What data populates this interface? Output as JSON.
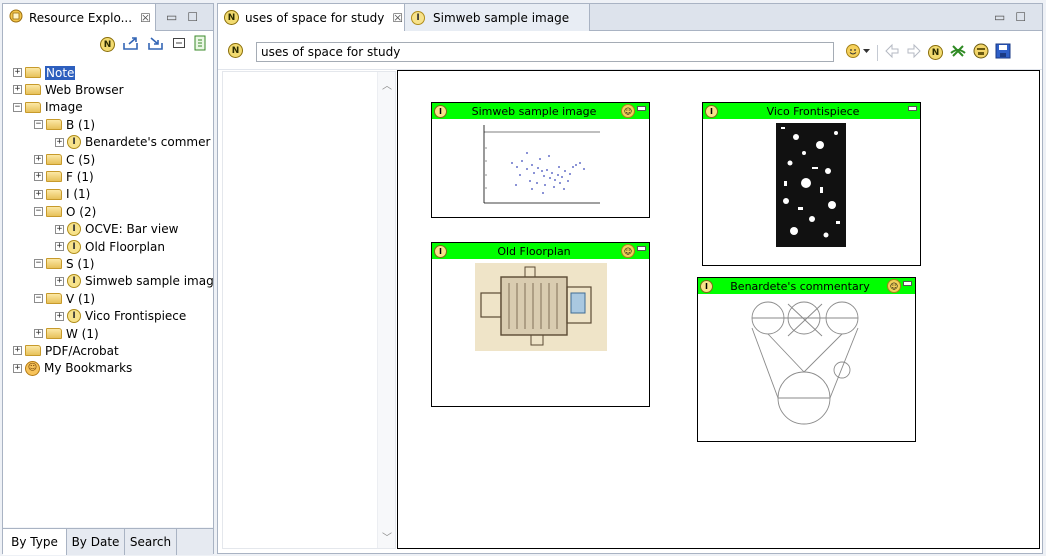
{
  "left_panel": {
    "view_title": "Resource Explo...",
    "close_glyph": "☒",
    "tree": [
      {
        "label": "Note",
        "kind": "folder",
        "expander": "+",
        "indent": 0,
        "selected": true
      },
      {
        "label": "Web Browser",
        "kind": "folder",
        "expander": "+",
        "indent": 0
      },
      {
        "label": "Image",
        "kind": "folder",
        "expander": "−",
        "indent": 0
      },
      {
        "label": "B (1)",
        "kind": "folder",
        "expander": "−",
        "indent": 1
      },
      {
        "label": "Benardete's commer",
        "kind": "item",
        "expander": "+",
        "indent": 2
      },
      {
        "label": "C (5)",
        "kind": "folder",
        "expander": "+",
        "indent": 1
      },
      {
        "label": "F (1)",
        "kind": "folder",
        "expander": "+",
        "indent": 1
      },
      {
        "label": "I (1)",
        "kind": "folder",
        "expander": "+",
        "indent": 1
      },
      {
        "label": "O (2)",
        "kind": "folder",
        "expander": "−",
        "indent": 1
      },
      {
        "label": "OCVE: Bar view",
        "kind": "item",
        "expander": "+",
        "indent": 2
      },
      {
        "label": "Old Floorplan",
        "kind": "item",
        "expander": "+",
        "indent": 2
      },
      {
        "label": "S (1)",
        "kind": "folder",
        "expander": "−",
        "indent": 1
      },
      {
        "label": "Simweb sample imag",
        "kind": "item",
        "expander": "+",
        "indent": 2
      },
      {
        "label": "V (1)",
        "kind": "folder",
        "expander": "−",
        "indent": 1
      },
      {
        "label": "Vico Frontispiece",
        "kind": "item",
        "expander": "+",
        "indent": 2
      },
      {
        "label": "W (1)",
        "kind": "folder",
        "expander": "+",
        "indent": 1
      },
      {
        "label": "PDF/Acrobat",
        "kind": "folder",
        "expander": "+",
        "indent": 0
      },
      {
        "label": "My Bookmarks",
        "kind": "bookmark",
        "expander": "+",
        "indent": 0
      }
    ],
    "bottom_tabs": [
      "By Type",
      "By Date",
      "Search"
    ]
  },
  "editor": {
    "tabs": [
      {
        "label": "uses of space for study",
        "active": true,
        "close": "☒"
      },
      {
        "label": "Simweb sample image",
        "active": false
      }
    ],
    "title_value": "uses of space for study",
    "toolbar_icon_names": [
      "smiley-menu-icon",
      "back-arrow-icon",
      "forward-arrow-icon",
      "note-icon",
      "unlink-icon",
      "people-icon",
      "save-icon"
    ],
    "cards": [
      {
        "title": "Simweb sample image",
        "kind": "scatter"
      },
      {
        "title": "Vico Frontispiece",
        "kind": "engraving"
      },
      {
        "title": "Old Floorplan",
        "kind": "floorplan"
      },
      {
        "title": "Benardete's commentary",
        "kind": "diagram"
      }
    ]
  },
  "colors": {
    "accent_green": "#00ff00",
    "selection_blue": "#2d5fbe",
    "panel_border": "#a9b3c3"
  }
}
